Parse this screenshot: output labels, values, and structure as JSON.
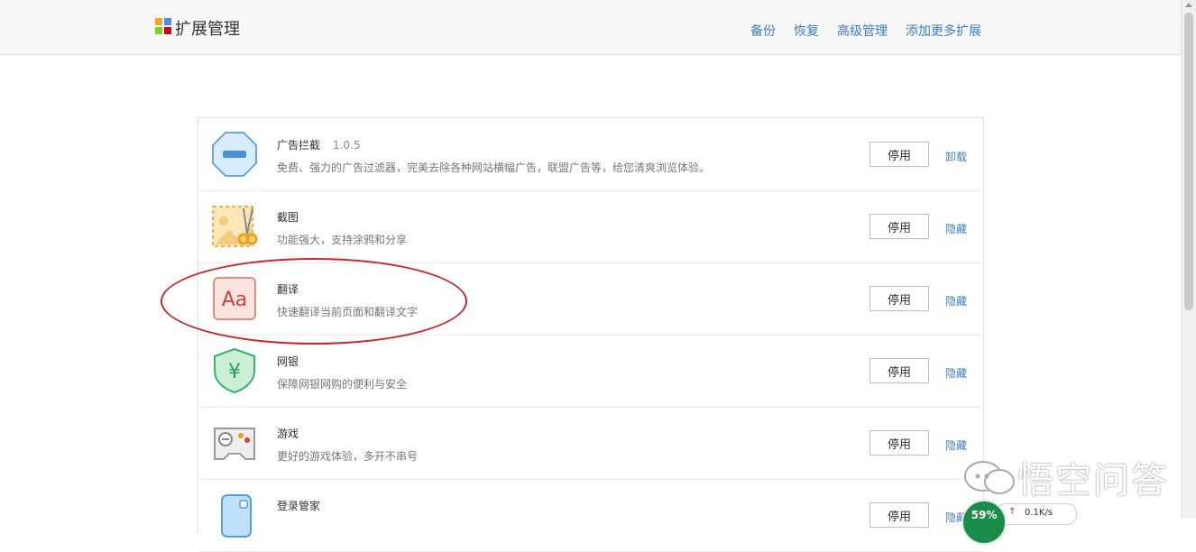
{
  "header": {
    "title": "扩展管理",
    "logo_colors": [
      "#f5a623",
      "#4a90e2",
      "#7ed321",
      "#d0021b"
    ],
    "nav": [
      "备份",
      "恢复",
      "高级管理",
      "添加更多扩展"
    ]
  },
  "extensions": [
    {
      "name": "广告拦截",
      "version": "1.0.5",
      "desc": "免费、强力的广告过滤器，完美去除各种网站横幅广告，联盟广告等，给您清爽浏览体验。",
      "button": "停用",
      "link": "卸载",
      "icon": "ad-block-icon"
    },
    {
      "name": "截图",
      "version": "",
      "desc": "功能强大，支持涂鸦和分享",
      "button": "停用",
      "link": "隐藏",
      "icon": "screenshot-icon"
    },
    {
      "name": "翻译",
      "version": "",
      "desc": "快速翻译当前页面和翻译文字",
      "button": "停用",
      "link": "隐藏",
      "icon": "translate-icon"
    },
    {
      "name": "网银",
      "version": "",
      "desc": "保障网银网购的便利与安全",
      "button": "停用",
      "link": "隐藏",
      "icon": "bank-shield-icon"
    },
    {
      "name": "游戏",
      "version": "",
      "desc": "更好的游戏体验，多开不串号",
      "button": "停用",
      "link": "隐藏",
      "icon": "gamepad-icon"
    },
    {
      "name": "登录管家",
      "version": "",
      "desc": "",
      "button": "停用",
      "link": "隐藏",
      "icon": "login-manager-icon"
    }
  ],
  "overlay": {
    "highlight_color": "#c8262b",
    "watermark_text": "悟空问答",
    "speed": {
      "percent": "59%",
      "rate": "0.1K/s"
    }
  }
}
